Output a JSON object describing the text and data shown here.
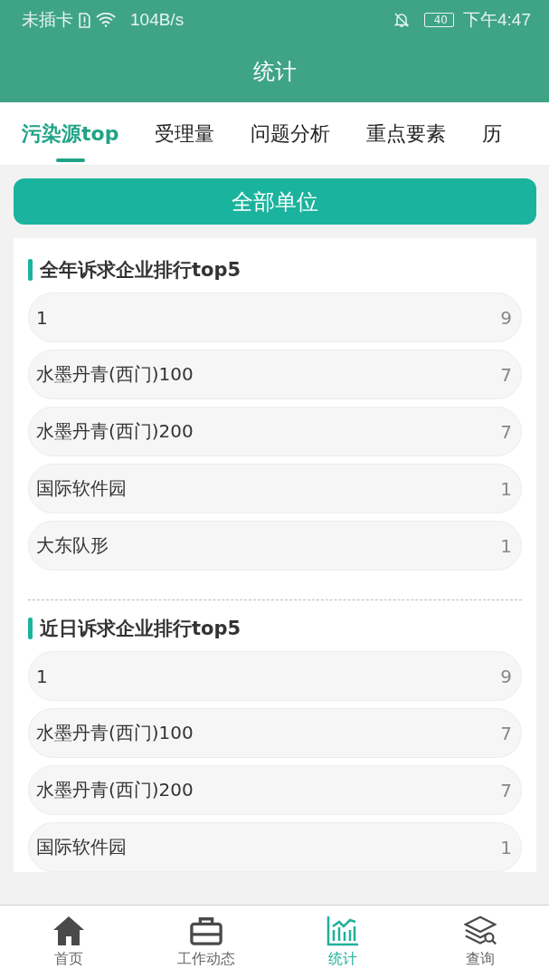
{
  "status_bar": {
    "carrier": "未插卡",
    "speed": "104B/s",
    "battery": "40",
    "time": "下午4:47"
  },
  "window": {
    "title": "统计"
  },
  "tabs": [
    {
      "label": "污染源top",
      "selected": true
    },
    {
      "label": "受理量",
      "selected": false
    },
    {
      "label": "问题分析",
      "selected": false
    },
    {
      "label": "重点要素",
      "selected": false
    },
    {
      "label": "历",
      "selected": false
    }
  ],
  "filter_button": "全部单位",
  "sections": [
    {
      "title": "全年诉求企业排行top5",
      "rows": [
        {
          "name": "1",
          "count": "9"
        },
        {
          "name": "水墨丹青(西门)100",
          "count": "7"
        },
        {
          "name": "水墨丹青(西门)200",
          "count": "7"
        },
        {
          "name": "国际软件园",
          "count": "1"
        },
        {
          "name": "大东队形",
          "count": "1"
        }
      ]
    },
    {
      "title": "近日诉求企业排行top5",
      "rows": [
        {
          "name": "1",
          "count": "9"
        },
        {
          "name": "水墨丹青(西门)100",
          "count": "7"
        },
        {
          "name": "水墨丹青(西门)200",
          "count": "7"
        },
        {
          "name": "国际软件园",
          "count": "1"
        }
      ]
    }
  ],
  "bottom_nav": [
    {
      "kind": "home",
      "label": "首页",
      "selected": false
    },
    {
      "kind": "briefcase",
      "label": "工作动态",
      "selected": false
    },
    {
      "kind": "chart",
      "label": "统计",
      "selected": true
    },
    {
      "kind": "layers",
      "label": "查询",
      "selected": false
    }
  ]
}
